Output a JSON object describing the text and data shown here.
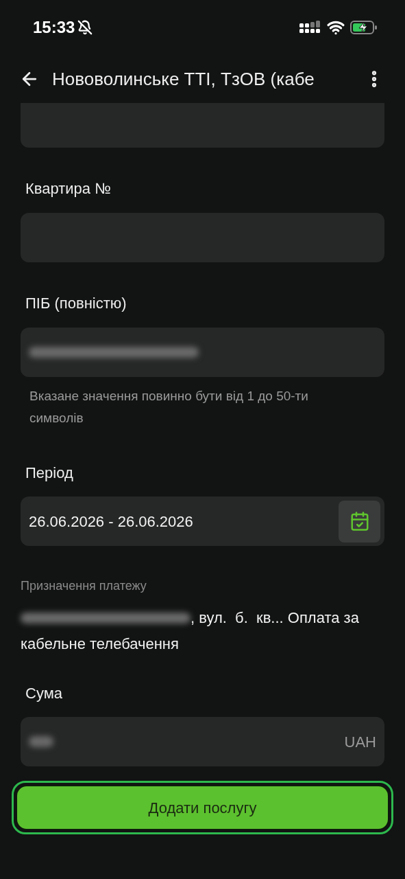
{
  "status_bar": {
    "time": "15:33"
  },
  "header": {
    "title": "Нововолинське ТТІ, ТзОВ (кабе"
  },
  "form": [
    {
      "kind": "field"
    },
    {
      "kind": "field",
      "label": "Квартира №"
    },
    {
      "kind": "field",
      "label": "ПІБ (повністю)",
      "redacted": true,
      "hint": "Вказане значення повинно бути від 1 до 50-ти символів"
    },
    {
      "kind": "date",
      "label": "Період",
      "value": "26.06.2026 - 26.06.2026"
    },
    {
      "kind": "text",
      "label": "Призначення платежу",
      "redacted": true,
      "lines": [
        ", вул.  б.  кв... Оплата за",
        "кабельне телебачення"
      ]
    },
    {
      "kind": "amount",
      "label": "Сума",
      "redacted": true,
      "suffix": "UAH"
    }
  ],
  "button": {
    "label": "Додати послугу"
  }
}
